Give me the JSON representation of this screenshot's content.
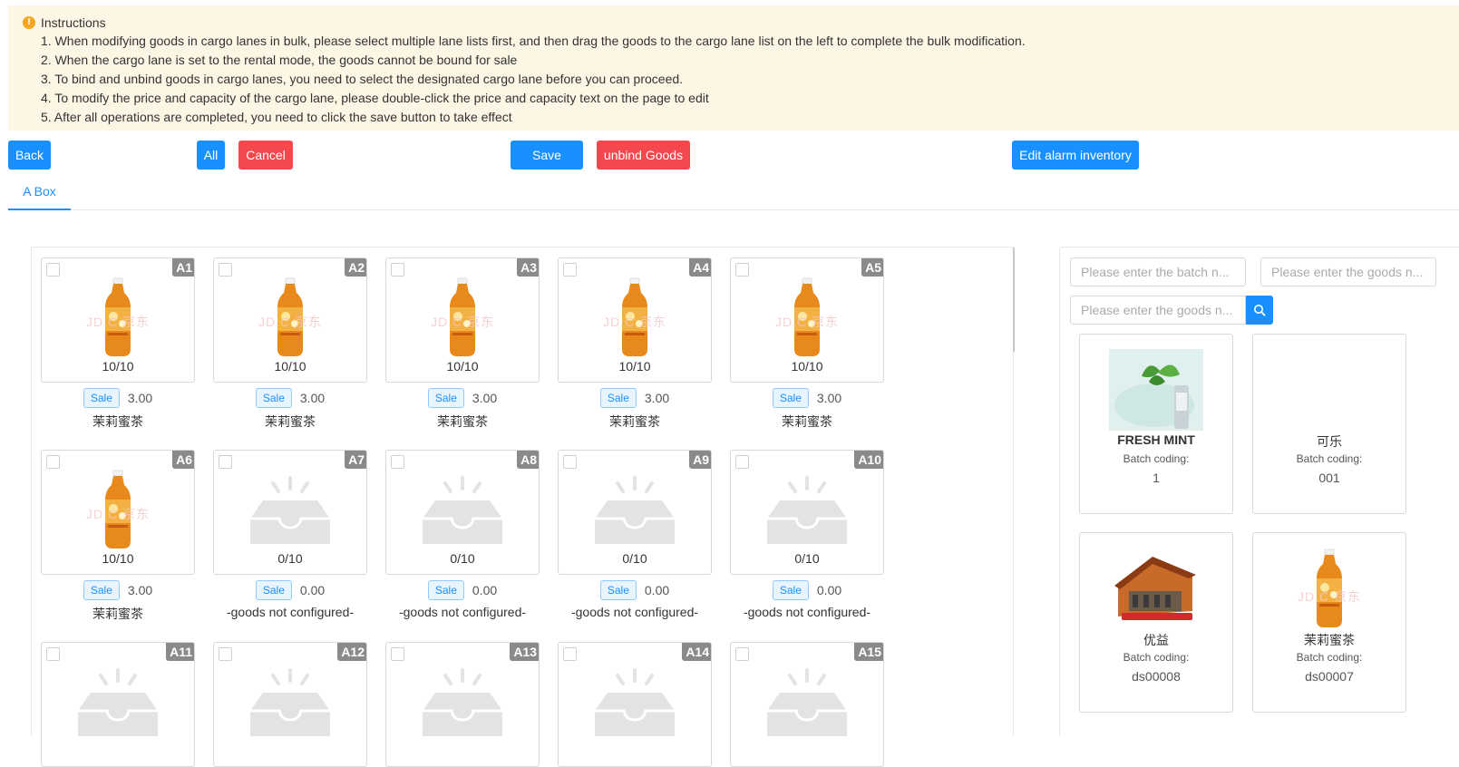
{
  "instructions": {
    "title": "Instructions",
    "items": [
      "1. When modifying goods in cargo lanes in bulk, please select multiple lane lists first, and then drag the goods to the cargo lane list on the left to complete the bulk modification.",
      "2. When the cargo lane is set to the rental mode, the goods cannot be bound for sale",
      "3. To bind and unbind goods in cargo lanes, you need to select the designated cargo lane before you can proceed.",
      "4. To modify the price and capacity of the cargo lane, please double-click the price and capacity text on the page to edit",
      "5. After all operations are completed, you need to click the save button to take effect"
    ]
  },
  "toolbar": {
    "back": "Back",
    "all": "All",
    "cancel": "Cancel",
    "save": "Save",
    "unbind": "unbind Goods",
    "edit_alarm": "Edit alarm inventory"
  },
  "tabs": [
    {
      "label": "A Box"
    }
  ],
  "watermark": "JD.C  京东",
  "lanes": [
    {
      "code": "A1",
      "stock": "10/10",
      "mode": "Sale",
      "price": "3.00",
      "goods": "茉莉蜜茶",
      "image": "bottle"
    },
    {
      "code": "A2",
      "stock": "10/10",
      "mode": "Sale",
      "price": "3.00",
      "goods": "茉莉蜜茶",
      "image": "bottle"
    },
    {
      "code": "A3",
      "stock": "10/10",
      "mode": "Sale",
      "price": "3.00",
      "goods": "茉莉蜜茶",
      "image": "bottle"
    },
    {
      "code": "A4",
      "stock": "10/10",
      "mode": "Sale",
      "price": "3.00",
      "goods": "茉莉蜜茶",
      "image": "bottle"
    },
    {
      "code": "A5",
      "stock": "10/10",
      "mode": "Sale",
      "price": "3.00",
      "goods": "茉莉蜜茶",
      "image": "bottle"
    },
    {
      "code": "A6",
      "stock": "10/10",
      "mode": "Sale",
      "price": "3.00",
      "goods": "茉莉蜜茶",
      "image": "bottle"
    },
    {
      "code": "A7",
      "stock": "0/10",
      "mode": "Sale",
      "price": "0.00",
      "goods": "-goods not configured-",
      "image": "empty"
    },
    {
      "code": "A8",
      "stock": "0/10",
      "mode": "Sale",
      "price": "0.00",
      "goods": "-goods not configured-",
      "image": "empty"
    },
    {
      "code": "A9",
      "stock": "0/10",
      "mode": "Sale",
      "price": "0.00",
      "goods": "-goods not configured-",
      "image": "empty"
    },
    {
      "code": "A10",
      "stock": "0/10",
      "mode": "Sale",
      "price": "0.00",
      "goods": "-goods not configured-",
      "image": "empty"
    },
    {
      "code": "A11",
      "image": "empty"
    },
    {
      "code": "A12",
      "image": "empty"
    },
    {
      "code": "A13",
      "image": "empty"
    },
    {
      "code": "A14",
      "image": "empty"
    },
    {
      "code": "A15",
      "image": "empty"
    }
  ],
  "search": {
    "batch_placeholder": "Please enter the batch n...",
    "goods_placeholder_1": "Please enter the goods n...",
    "goods_placeholder_2": "Please enter the goods n..."
  },
  "goods_list": [
    {
      "name": "FRESH MINT",
      "batch_label": "Batch coding:",
      "batch": "1",
      "image": "mint"
    },
    {
      "name": "可乐",
      "batch_label": "Batch coding:",
      "batch": "001",
      "image": "none"
    },
    {
      "name": "优益",
      "batch_label": "Batch coding:",
      "batch": "ds00008",
      "image": "house"
    },
    {
      "name": "茉莉蜜茶",
      "batch_label": "Batch coding:",
      "batch": "ds00007",
      "image": "bottle"
    }
  ],
  "colors": {
    "primary": "#1890ff",
    "danger": "#f5474e",
    "notice_bg": "#fdf6e5",
    "warning": "#f4a623"
  }
}
